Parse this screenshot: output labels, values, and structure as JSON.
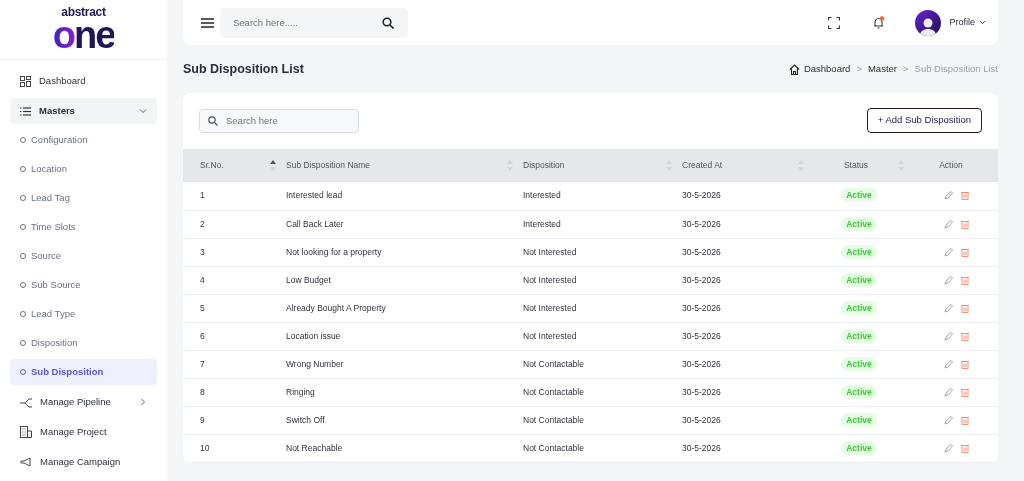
{
  "logo": {
    "line_1": "abstract",
    "line_2": "one"
  },
  "sidebar": {
    "items": [
      {
        "kind": "link",
        "label": "Dashboard"
      },
      {
        "kind": "group",
        "label": "Masters",
        "expanded": true,
        "children": [
          {
            "label": "Configuration",
            "selected": false
          },
          {
            "label": "Location",
            "selected": false
          },
          {
            "label": "Lead Tag",
            "selected": false
          },
          {
            "label": "Time Slots",
            "selected": false
          },
          {
            "label": "Source",
            "selected": false
          },
          {
            "label": "Sub Source",
            "selected": false
          },
          {
            "label": "Lead Type",
            "selected": false
          },
          {
            "label": "Disposition",
            "selected": false
          },
          {
            "label": "Sub Disposition",
            "selected": true
          }
        ]
      },
      {
        "kind": "group",
        "label": "Manage Pipeline",
        "expanded": false
      },
      {
        "kind": "link",
        "label": "Manage Project"
      },
      {
        "kind": "link",
        "label": "Manage Campaign"
      }
    ]
  },
  "topbar": {
    "search": {
      "placeholder": "Search here....."
    },
    "notification_dot": true,
    "profile": "Profile"
  },
  "page_title": "Sub Disposition List",
  "breadcrumb": [
    {
      "label": "Dashboard",
      "current": false
    },
    {
      "label": "Master",
      "current": false
    },
    {
      "label": "Sub Disposition List",
      "current": true
    }
  ],
  "breadcrumb_separator": ">",
  "table_search": {
    "placeholder": "Search here"
  },
  "add_button": {
    "icon": "+",
    "label": "Add Sub Disposition"
  },
  "table": {
    "columns": [
      {
        "label": "Sr.No.",
        "sortable": true,
        "sorted": true
      },
      {
        "label": "Sub Disposition Name",
        "sortable": true,
        "sorted": false
      },
      {
        "label": "Disposition",
        "sortable": true,
        "sorted": false
      },
      {
        "label": "Created At",
        "sortable": true,
        "sorted": false
      },
      {
        "label": "Status",
        "sortable": true,
        "sorted": false
      },
      {
        "label": "Action",
        "sortable": false,
        "sorted": false
      }
    ],
    "rows": [
      {
        "sr": "1",
        "name": "Interested lead",
        "disposition": "Interested",
        "created": "30-5-2026",
        "status": "Active"
      },
      {
        "sr": "2",
        "name": "Call Back Later",
        "disposition": "Interested",
        "created": "30-5-2026",
        "status": "Active"
      },
      {
        "sr": "3",
        "name": "Not looking for a property",
        "disposition": "Not Interested",
        "created": "30-5-2026",
        "status": "Active"
      },
      {
        "sr": "4",
        "name": "Low Budget",
        "disposition": "Not Interested",
        "created": "30-5-2026",
        "status": "Active"
      },
      {
        "sr": "5",
        "name": "Already Bought A Property",
        "disposition": "Not Interested",
        "created": "30-5-2026",
        "status": "Active"
      },
      {
        "sr": "6",
        "name": "Location issue",
        "disposition": "Not Interested",
        "created": "30-5-2026",
        "status": "Active"
      },
      {
        "sr": "7",
        "name": "Wrong Number",
        "disposition": "Not Contactable",
        "created": "30-5-2026",
        "status": "Active"
      },
      {
        "sr": "8",
        "name": "Ringing",
        "disposition": "Not Contactable",
        "created": "30-5-2026",
        "status": "Active"
      },
      {
        "sr": "9",
        "name": "Switch Off",
        "disposition": "Not Contactable",
        "created": "30-5-2026",
        "status": "Active"
      },
      {
        "sr": "10",
        "name": "Not Reachable",
        "disposition": "Not Contactable",
        "created": "30-5-2026",
        "status": "Active"
      }
    ]
  }
}
